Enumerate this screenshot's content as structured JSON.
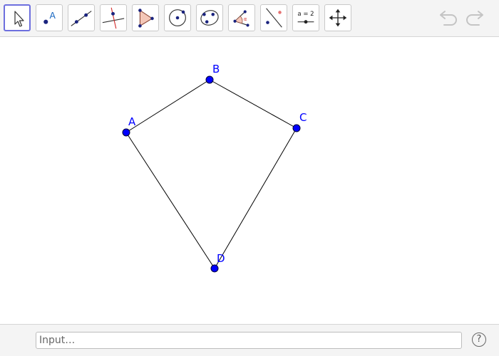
{
  "toolbar": {
    "tools": [
      {
        "name": "move-tool",
        "icon": "pointer-arrow-icon",
        "selected": true
      },
      {
        "name": "point-tool",
        "icon": "point-icon",
        "label": "A"
      },
      {
        "name": "line-tool",
        "icon": "line-through-two-points-icon"
      },
      {
        "name": "perpendicular-line-tool",
        "icon": "perpendicular-line-icon"
      },
      {
        "name": "polygon-tool",
        "icon": "polygon-icon"
      },
      {
        "name": "circle-tool",
        "icon": "circle-center-point-icon"
      },
      {
        "name": "conic-tool",
        "icon": "ellipse-icon"
      },
      {
        "name": "angle-tool",
        "icon": "angle-icon",
        "label": "α"
      },
      {
        "name": "reflect-tool",
        "icon": "reflect-about-line-icon"
      },
      {
        "name": "slider-tool",
        "icon": "slider-icon",
        "label": "a = 2"
      },
      {
        "name": "move-graphics-view-tool",
        "icon": "move-arrows-icon"
      }
    ],
    "undo_icon": "undo-icon",
    "redo_icon": "redo-icon"
  },
  "points": {
    "A": {
      "label": "A"
    },
    "B": {
      "label": "B"
    },
    "C": {
      "label": "C"
    },
    "D": {
      "label": "D"
    }
  },
  "colors": {
    "point_fill": "#0000ff",
    "label": "#0000ff",
    "segment": "#000000",
    "selected_tool_border": "#6d6fde"
  },
  "input_bar": {
    "placeholder": "Input…",
    "value": "",
    "help_label": "?"
  }
}
